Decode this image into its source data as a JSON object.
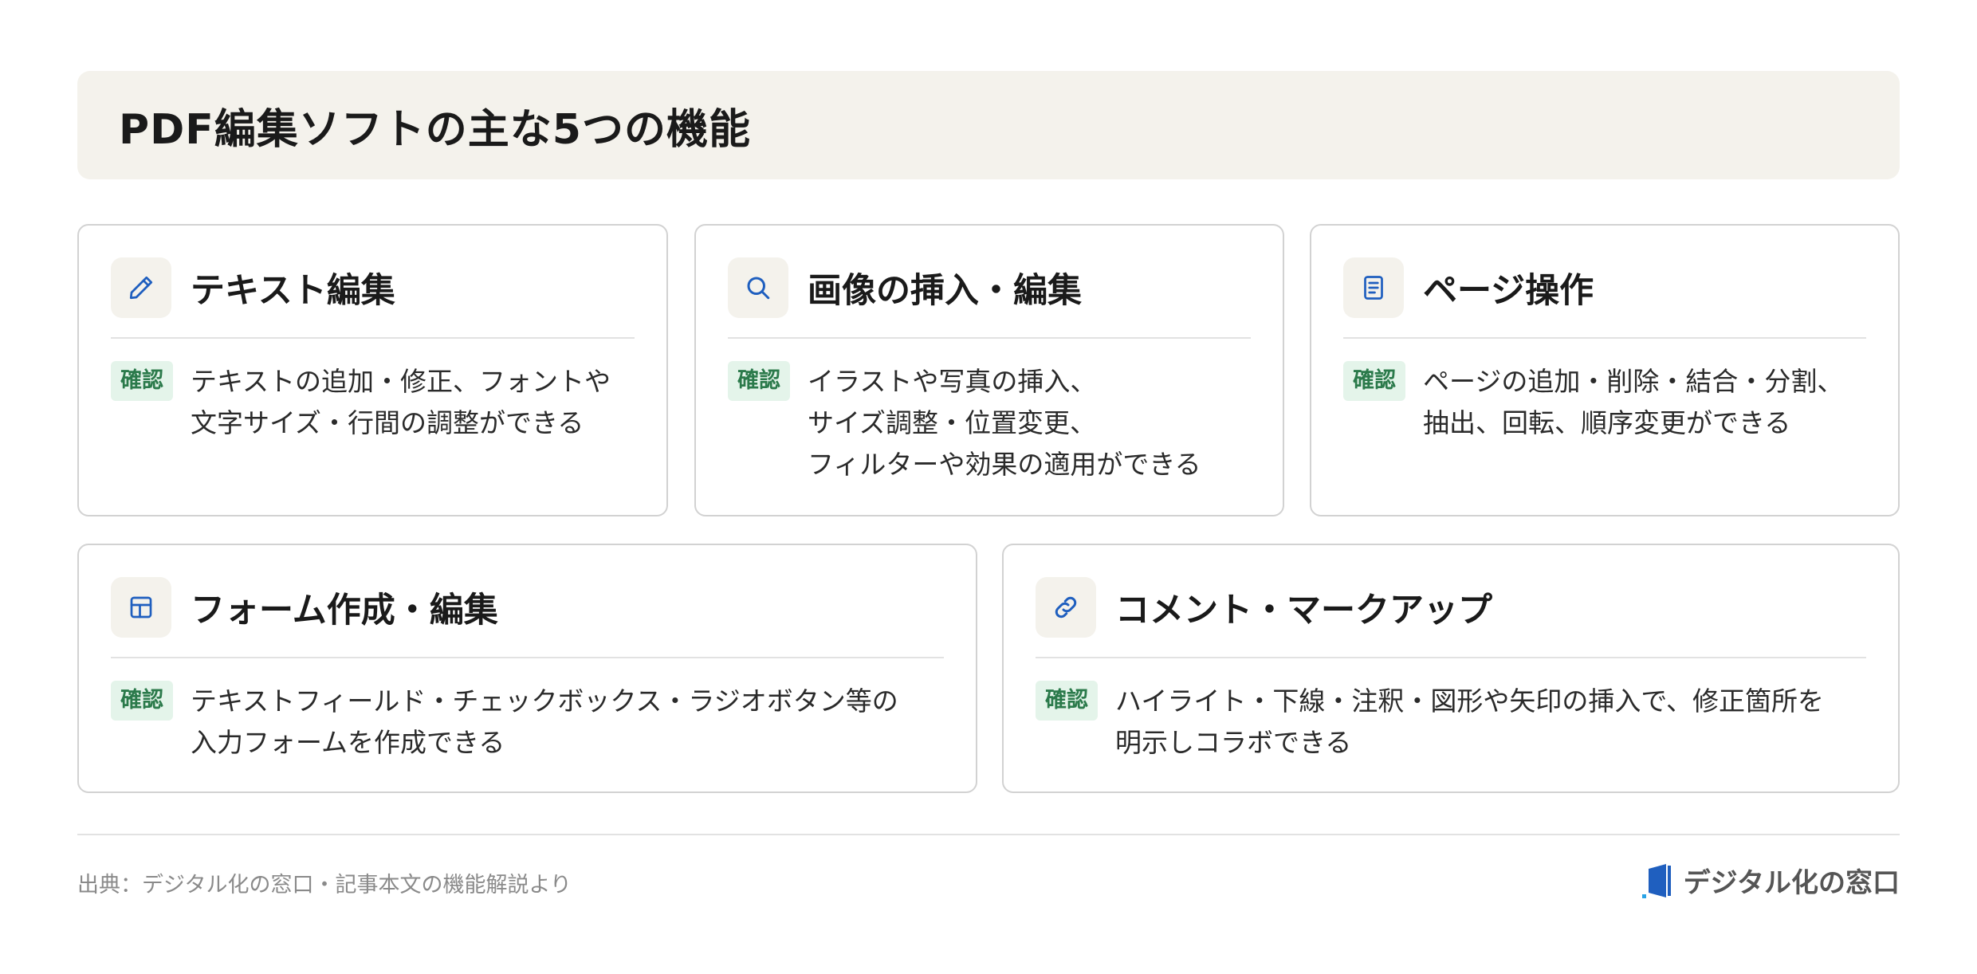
{
  "title": "PDF編集ソフトの主な5つの機能",
  "badge_label": "確認",
  "cards": [
    {
      "icon": "pencil-icon",
      "title": "テキスト編集",
      "lines": [
        "テキストの追加・修正、フォントや",
        "文字サイズ・行間の調整ができる"
      ]
    },
    {
      "icon": "search-icon",
      "title": "画像の挿入・編集",
      "lines": [
        "イラストや写真の挿入、",
        "サイズ調整・位置変更、",
        "フィルターや効果の適用ができる"
      ]
    },
    {
      "icon": "document-icon",
      "title": "ページ操作",
      "lines": [
        "ページの追加・削除・結合・分割、",
        "抽出、回転、順序変更ができる"
      ]
    },
    {
      "icon": "table-icon",
      "title": "フォーム作成・編集",
      "lines": [
        "テキストフィールド・チェックボックス・ラジオボタン等の",
        "入力フォームを作成できる"
      ]
    },
    {
      "icon": "link-icon",
      "title": "コメント・マークアップ",
      "lines": [
        "ハイライト・下線・注釈・図形や矢印の挿入で、修正箇所を",
        "明示しコラボできる"
      ]
    }
  ],
  "footer": {
    "source": "出典：デジタル化の窓口・記事本文の機能解説より",
    "brand": "デジタル化の窓口"
  },
  "colors": {
    "accent_blue": "#1f5fbf",
    "badge_green": "#2b7a4b",
    "badge_bg": "#e4f4ea",
    "header_bg": "#f4f2ec"
  }
}
